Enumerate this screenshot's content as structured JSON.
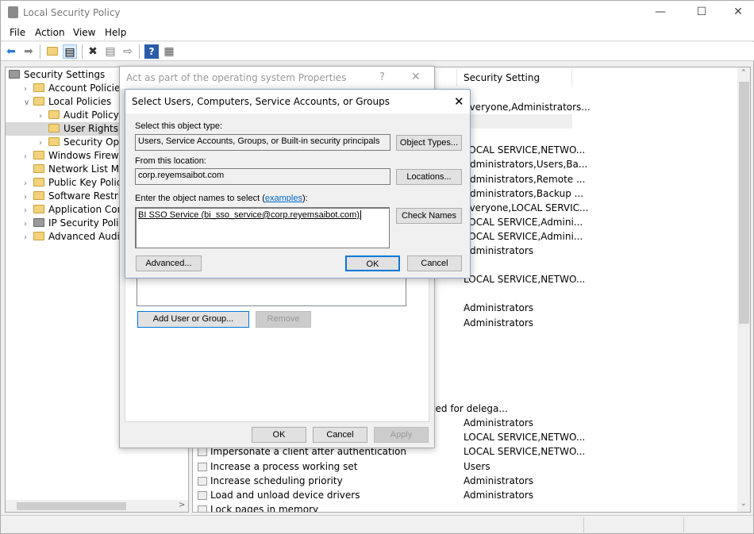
{
  "window": {
    "title": "Local Security Policy",
    "icon": "security-policy-icon"
  },
  "menu": [
    "File",
    "Action",
    "View",
    "Help"
  ],
  "toolbar": [
    "back-icon",
    "forward-icon",
    "up-folder-icon",
    "show-hide-tree-icon",
    "delete-icon",
    "properties-icon",
    "export-list-icon",
    "help-icon",
    "show-action-pane-icon"
  ],
  "tree": [
    {
      "label": "Security Settings",
      "level": 0,
      "expander": ""
    },
    {
      "label": "Account Policies",
      "level": 1,
      "expander": ">"
    },
    {
      "label": "Local Policies",
      "level": 1,
      "expander": "v"
    },
    {
      "label": "Audit Policy",
      "level": 2,
      "expander": ">"
    },
    {
      "label": "User Rights Assignment",
      "level": 2,
      "expander": "",
      "selected": true
    },
    {
      "label": "Security Options",
      "level": 2,
      "expander": ">"
    },
    {
      "label": "Windows Firewall with Advanced Security",
      "level": 1,
      "expander": ">"
    },
    {
      "label": "Network List Manager Policies",
      "level": 1,
      "expander": ""
    },
    {
      "label": "Public Key Policies",
      "level": 1,
      "expander": ">"
    },
    {
      "label": "Software Restriction Policies",
      "level": 1,
      "expander": ">"
    },
    {
      "label": "Application Control Policies",
      "level": 1,
      "expander": ">"
    },
    {
      "label": "IP Security Policies on Local Computer",
      "level": 1,
      "expander": ">"
    },
    {
      "label": "Advanced Audit Policy Configuration",
      "level": 1,
      "expander": ">"
    }
  ],
  "list": {
    "columns": {
      "setting": "Security Setting"
    },
    "rows": [
      {
        "policy": "",
        "setting": "Everyone,Administrators..."
      },
      {
        "policy": "",
        "setting": "",
        "highlighted": true
      },
      {
        "policy": "",
        "setting": ""
      },
      {
        "policy": "",
        "setting": "LOCAL SERVICE,NETWO..."
      },
      {
        "policy": "",
        "setting": "Administrators,Users,Ba..."
      },
      {
        "policy": "",
        "setting": "Administrators,Remote ..."
      },
      {
        "policy": "",
        "setting": "Administrators,Backup ..."
      },
      {
        "policy": "",
        "setting": "Everyone,LOCAL SERVIC..."
      },
      {
        "policy": "",
        "setting": "LOCAL SERVICE,Admini..."
      },
      {
        "policy": "",
        "setting": "LOCAL SERVICE,Admini..."
      },
      {
        "policy": "",
        "setting": "Administrators"
      },
      {
        "policy": "",
        "setting": ""
      },
      {
        "policy": "",
        "setting": "LOCAL SERVICE,NETWO..."
      },
      {
        "policy": "",
        "setting": ""
      },
      {
        "policy": "",
        "setting": "Administrators"
      },
      {
        "policy": "",
        "setting": "Administrators"
      },
      {
        "policy": "",
        "setting": ""
      },
      {
        "policy": "",
        "setting": ""
      },
      {
        "policy": "",
        "setting": ""
      },
      {
        "policy": "",
        "setting": ""
      },
      {
        "policy": "",
        "setting": ""
      },
      {
        "policy": "Enable computer and user accounts to be trusted for delega...",
        "setting": ""
      },
      {
        "policy": "",
        "setting": "Administrators"
      },
      {
        "policy": "",
        "setting": "LOCAL SERVICE,NETWO..."
      },
      {
        "policy": "Impersonate a client after authentication",
        "setting": "LOCAL SERVICE,NETWO..."
      },
      {
        "policy": "Increase a process working set",
        "setting": "Users"
      },
      {
        "policy": "Increase scheduling priority",
        "setting": "Administrators"
      },
      {
        "policy": "Load and unload device drivers",
        "setting": "Administrators"
      },
      {
        "policy": "Lock pages in memory",
        "setting": ""
      }
    ]
  },
  "properties_dialog": {
    "title": "Act as part of the operating system Properties",
    "help": "?",
    "close": "✕",
    "add_button": "Add User or Group...",
    "remove_button": "Remove",
    "ok": "OK",
    "cancel": "Cancel",
    "apply": "Apply"
  },
  "select_dialog": {
    "title": "Select Users, Computers, Service Accounts, or Groups",
    "close": "✕",
    "object_type_label": "Select this object type:",
    "object_type_value": "Users, Service Accounts, Groups, or Built-in security principals",
    "object_types_button": "Object Types...",
    "location_label": "From this location:",
    "location_value": "corp.reyemsaibot.com",
    "locations_button": "Locations...",
    "names_label": "Enter the object names to select (",
    "names_link": "examples",
    "names_label_end": "):",
    "names_value": "BI SSO Service (bi_sso_service@corp.reyemsaibot.com)",
    "check_names_button": "Check Names",
    "advanced_button": "Advanced...",
    "ok": "OK",
    "cancel": "Cancel"
  }
}
